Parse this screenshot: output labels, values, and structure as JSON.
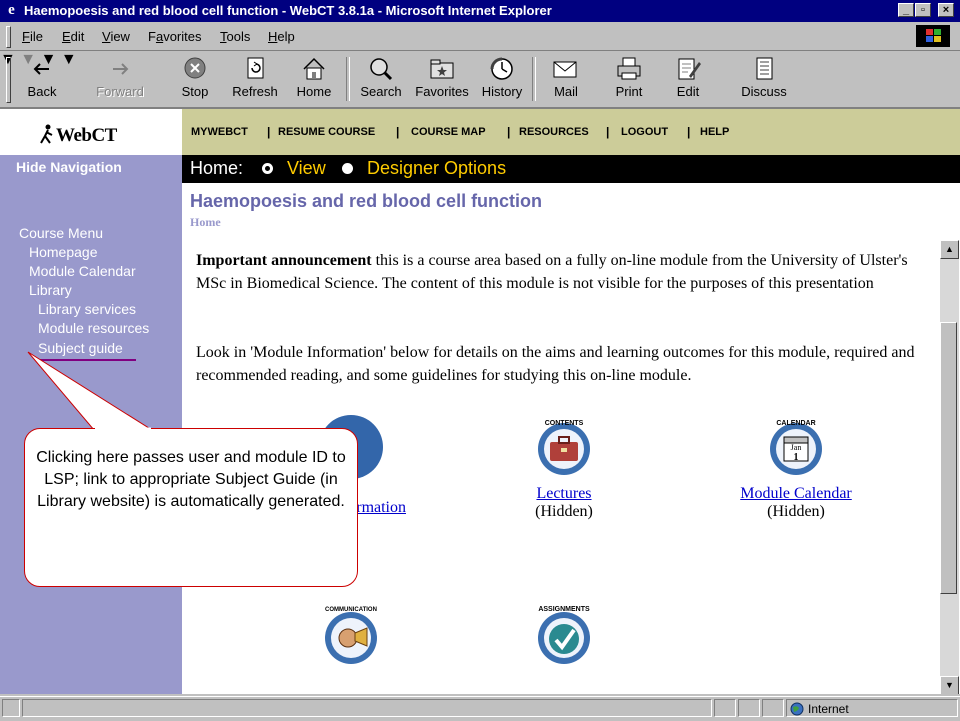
{
  "window": {
    "title": "Haemopoesis and red blood cell function - WebCT 3.8.1a - Microsoft Internet Explorer",
    "minimize": "_",
    "maximize": "▫",
    "close": "×"
  },
  "menu": [
    {
      "key": "F",
      "rest": "ile"
    },
    {
      "key": "E",
      "rest": "dit"
    },
    {
      "key": "V",
      "rest": "iew"
    },
    {
      "pre": "F",
      "key": "a",
      "rest": "vorites"
    },
    {
      "key": "T",
      "rest": "ools"
    },
    {
      "key": "H",
      "rest": "elp"
    }
  ],
  "toolbar": {
    "back": "Back",
    "forward": "Forward",
    "stop": "Stop",
    "refresh": "Refresh",
    "home": "Home",
    "search": "Search",
    "favorites": "Favorites",
    "history": "History",
    "mail": "Mail",
    "print": "Print",
    "edit": "Edit",
    "discuss": "Discuss"
  },
  "logo": "WebCT",
  "top_nav": [
    "MYWEBCT",
    "RESUME COURSE",
    "COURSE MAP",
    "RESOURCES",
    "LOGOUT",
    "HELP"
  ],
  "top_nav_separator": "|",
  "home_bar": {
    "label": "Home:",
    "view": "View",
    "designer": "Designer Options",
    "selected": "View"
  },
  "left_nav": {
    "hide": "Hide Navigation",
    "course_menu": "Course Menu",
    "homepage": "Homepage",
    "module_calendar": "Module Calendar",
    "library": "Library",
    "library_services": "Library services",
    "module_resources": "Module resources",
    "subject_guide": "Subject guide"
  },
  "page": {
    "title": "Haemopoesis and red blood cell function",
    "breadcrumb": "Home"
  },
  "announcement": {
    "bold": "Important announcement",
    "text": " this is a course area based on a fully on-line module from the University of Ulster's MSc in Biomedical Science. The content of this module is not visible for the purposes of this presentation"
  },
  "info_text": "Look in 'Module Information' below for details on the aims and learning outcomes for this module, required and recommended reading, and some guidelines for studying this on-line module.",
  "tools": {
    "module_info_partial": "rmation",
    "lectures": "Lectures",
    "lectures_status": "(Hidden)",
    "lectures_icon_label": "CONTENTS",
    "calendar": "Module Calendar",
    "calendar_status": "(Hidden)",
    "calendar_icon_label": "CALENDAR",
    "calendar_icon_date": "Jan",
    "calendar_icon_day": "1",
    "communication_icon_label": "COMMUNICATION",
    "assignments_icon_label": "ASSIGNMENTS"
  },
  "callout": "Clicking here passes user and module ID to LSP; link to appropriate Subject Guide (in Library website) is automatically generated.",
  "status": {
    "zone": "Internet"
  },
  "colors": {
    "titlebar": "#000080",
    "left_nav": "#9999cc",
    "top_nav": "#cccc99",
    "home_bar": "#000000",
    "home_bar_text": "#ffcc00",
    "page_title": "#6666aa",
    "link": "#0000cc",
    "callout_border": "#cc0000"
  }
}
